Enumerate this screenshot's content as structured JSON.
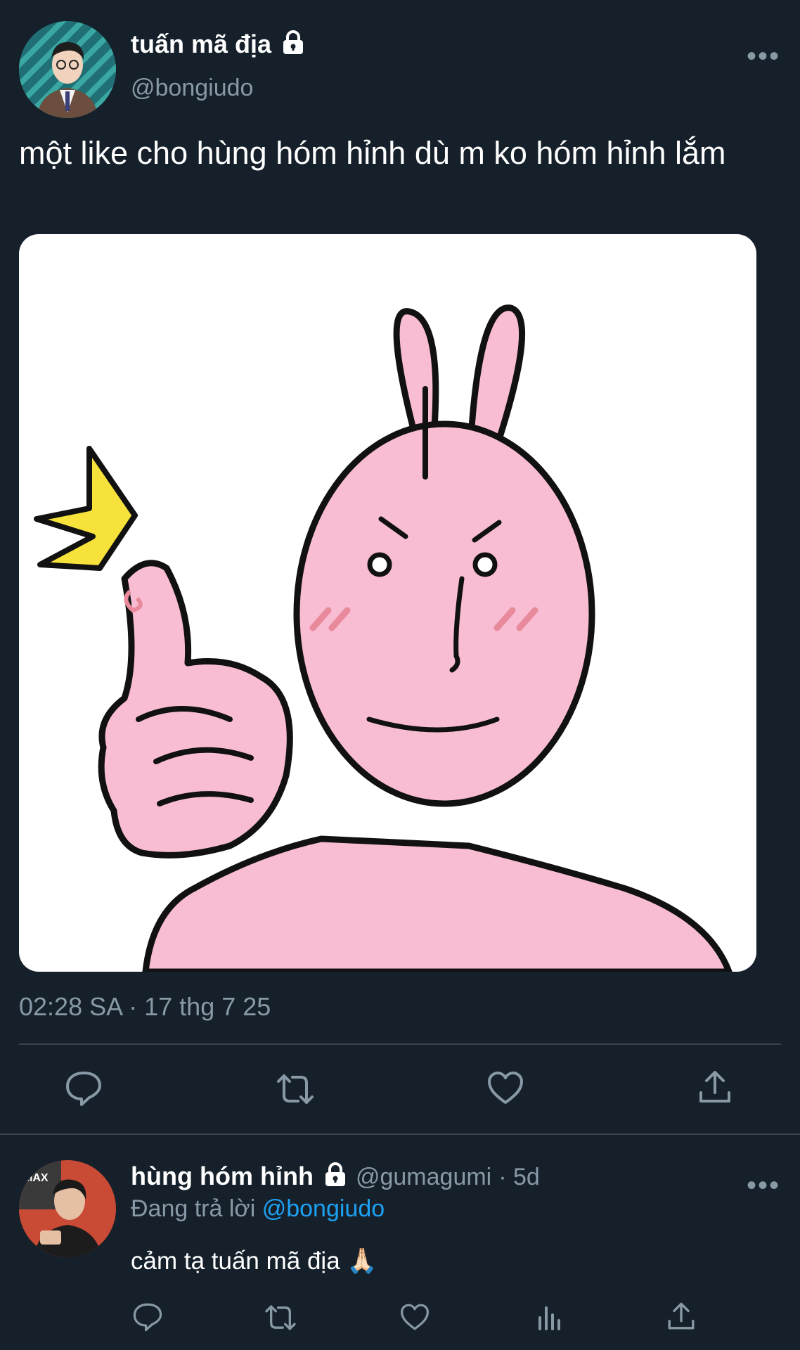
{
  "tweet": {
    "author_name": "tuấn mã địa",
    "author_handle": "@bongiudo",
    "more_label": "•••",
    "text": "một like cho hùng hóm hỉnh dù m ko hóm hỉnh lắm",
    "timestamp": "02:28 SA · 17 thg 7 25",
    "actions": [
      "reply-icon",
      "retweet-icon",
      "like-icon",
      "share-icon"
    ]
  },
  "reply": {
    "author_name": "hùng hóm hỉnh",
    "author_handle": "@gumagumi",
    "time_ago": "· 5d",
    "more_label": "•••",
    "replying_prefix": "Đang trả lời",
    "replying_to": "@bongiudo",
    "text": "cảm tạ tuấn mã địa 🙏🏻",
    "actions": [
      "reply-icon",
      "retweet-icon",
      "like-icon",
      "analytics-icon",
      "share-icon"
    ]
  },
  "colors": {
    "background": "#15202b",
    "secondary_text": "#8899a6",
    "link": "#1da1f2",
    "divider": "#38444d",
    "sticker_pink": "#f9bdd3"
  }
}
